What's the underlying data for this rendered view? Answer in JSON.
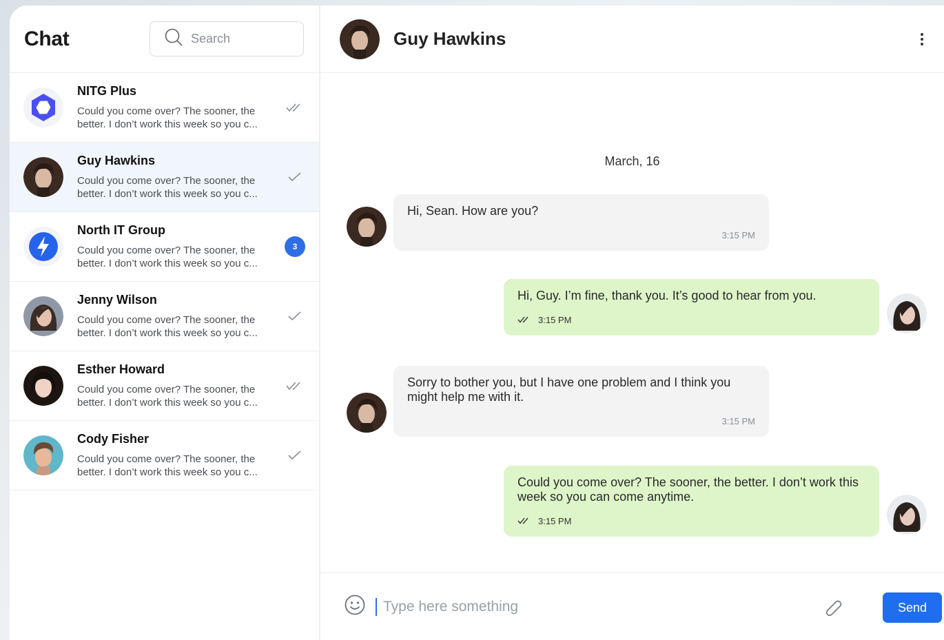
{
  "sidebar": {
    "title": "Chat",
    "search_placeholder": "Search",
    "conversations": [
      {
        "name": "NITG Plus",
        "preview": "Could you come over? The sooner, the better. I don’t work this week so you c...",
        "status": "read",
        "avatar": "nitg-logo"
      },
      {
        "name": "Guy Hawkins",
        "preview": "Could you come over? The sooner, the better. I don’t work this week so you c...",
        "status": "sent",
        "avatar": "guy-hawkins-photo"
      },
      {
        "name": "North IT Group",
        "preview": "Could you come over? The sooner, the better. I don’t work this week so you c...",
        "status": "unread",
        "unread_count": "3",
        "avatar": "north-it-logo"
      },
      {
        "name": "Jenny Wilson",
        "preview": "Could you come over? The sooner, the better. I don’t work this week so you c...",
        "status": "sent",
        "avatar": "jenny-wilson-photo"
      },
      {
        "name": "Esther Howard",
        "preview": "Could you come over? The sooner, the better. I don’t work this week so you c...",
        "status": "read",
        "avatar": "esther-howard-photo"
      },
      {
        "name": "Cody Fisher",
        "preview": "Could you come over? The sooner, the better. I don’t work this week so you c...",
        "status": "sent",
        "avatar": "cody-fisher-photo"
      }
    ]
  },
  "chat": {
    "contact_name": "Guy Hawkins",
    "date_separator": "March, 16",
    "messages": [
      {
        "direction": "in",
        "text": "Hi, Sean. How are you?",
        "time": "3:15 PM"
      },
      {
        "direction": "out",
        "text": "Hi, Guy. I’m fine, thank you. It’s good to hear from you.",
        "time": "3:15 PM"
      },
      {
        "direction": "in",
        "text": "Sorry to bother you, but I have one problem and I think you might help me with it.",
        "time": "3:15 PM"
      },
      {
        "direction": "out",
        "text": "Could you come over? The sooner, the better. I don’t work this week so you can come anytime.",
        "time": "3:15 PM"
      }
    ]
  },
  "composer": {
    "placeholder": "Type here something",
    "send_label": "Send"
  },
  "colors": {
    "accent": "#1f6ef0",
    "badge": "#2f6de6",
    "active_row": "#f1f6fd",
    "incoming_bubble": "#f3f3f4",
    "outgoing_bubble": "#ddf5c8"
  }
}
